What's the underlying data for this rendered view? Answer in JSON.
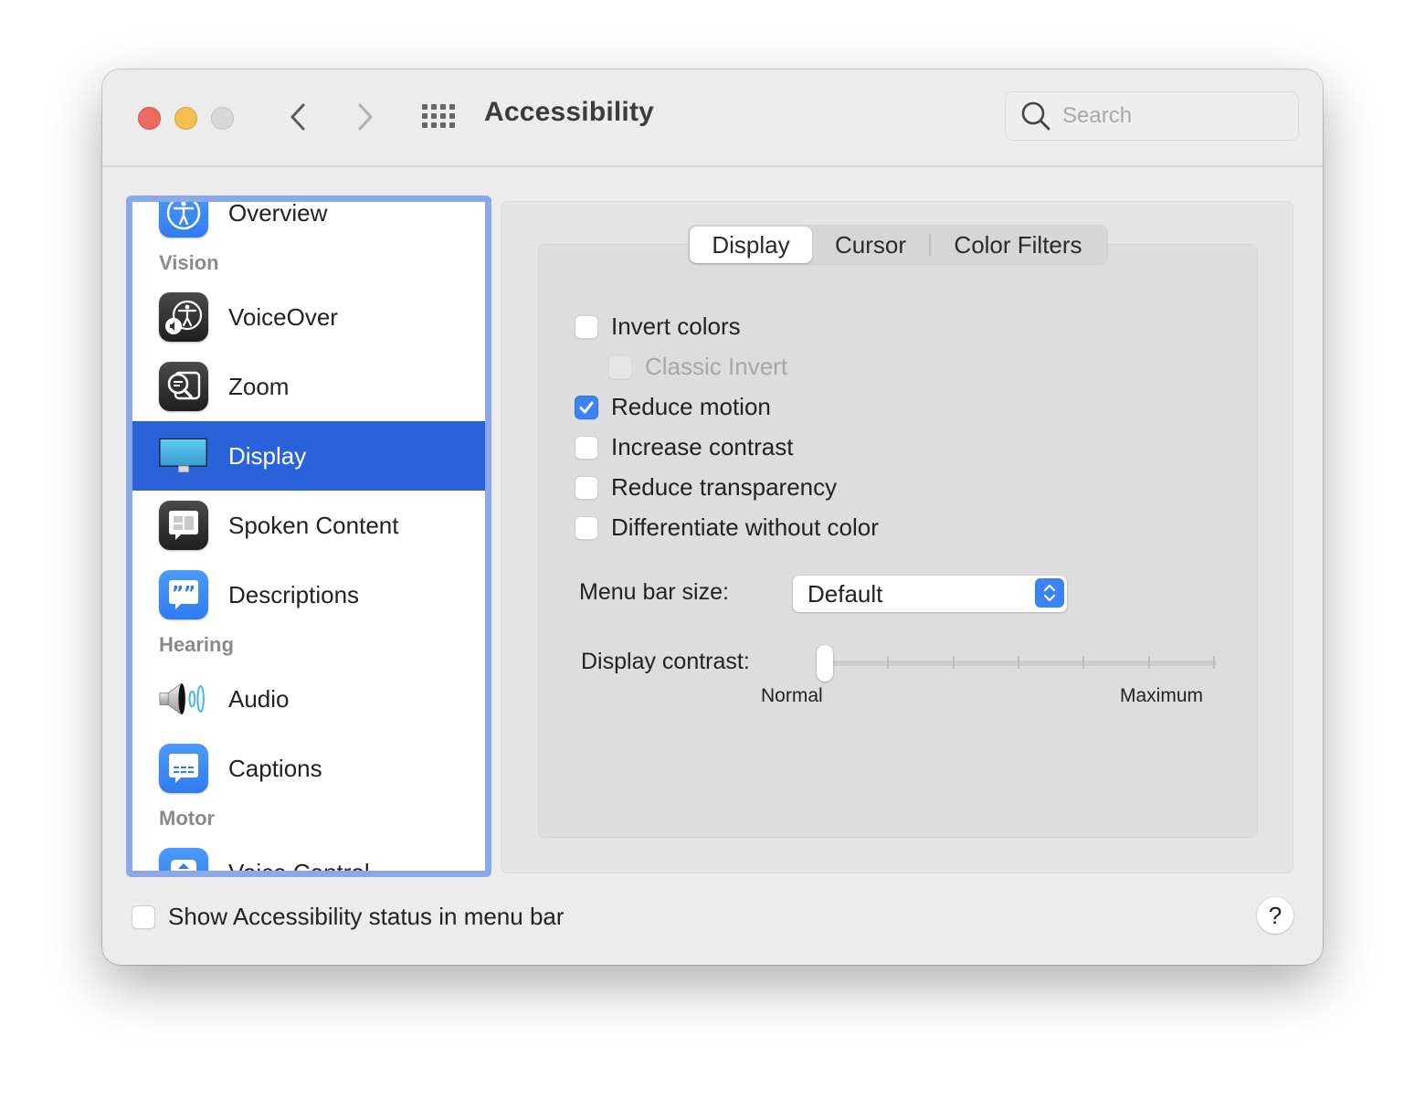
{
  "window": {
    "title": "Accessibility",
    "search": {
      "placeholder": "Search",
      "value": ""
    },
    "icons": {
      "close": "close-button",
      "minimize": "minimize-button",
      "zoom": "zoom-button",
      "back": "chevron-left-icon",
      "forward": "chevron-right-icon",
      "show_all": "grid-icon",
      "search": "magnifier-icon"
    }
  },
  "sidebar": {
    "items": [
      {
        "type": "item",
        "label": "Overview",
        "icon": "accessibility-person-icon",
        "selected": false
      },
      {
        "type": "section",
        "label": "Vision"
      },
      {
        "type": "item",
        "label": "VoiceOver",
        "icon": "voiceover-icon",
        "selected": false
      },
      {
        "type": "item",
        "label": "Zoom",
        "icon": "zoom-magnifier-icon",
        "selected": false
      },
      {
        "type": "item",
        "label": "Display",
        "icon": "monitor-icon",
        "selected": true
      },
      {
        "type": "item",
        "label": "Spoken Content",
        "icon": "speech-bubble-icon",
        "selected": false
      },
      {
        "type": "item",
        "label": "Descriptions",
        "icon": "quote-bubble-icon",
        "selected": false
      },
      {
        "type": "section",
        "label": "Hearing"
      },
      {
        "type": "item",
        "label": "Audio",
        "icon": "speaker-icon",
        "selected": false
      },
      {
        "type": "item",
        "label": "Captions",
        "icon": "captions-bubble-icon",
        "selected": false
      },
      {
        "type": "section",
        "label": "Motor"
      },
      {
        "type": "item",
        "label": "Voice Control",
        "icon": "voice-control-icon",
        "selected": false
      }
    ]
  },
  "main": {
    "tabs": [
      {
        "label": "Display",
        "active": true
      },
      {
        "label": "Cursor",
        "active": false
      },
      {
        "label": "Color Filters",
        "active": false
      }
    ],
    "options": [
      {
        "label": "Invert colors",
        "checked": false,
        "disabled": false,
        "indent": false
      },
      {
        "label": "Classic Invert",
        "checked": false,
        "disabled": true,
        "indent": true
      },
      {
        "label": "Reduce motion",
        "checked": true,
        "disabled": false,
        "indent": false
      },
      {
        "label": "Increase contrast",
        "checked": false,
        "disabled": false,
        "indent": false
      },
      {
        "label": "Reduce transparency",
        "checked": false,
        "disabled": false,
        "indent": false
      },
      {
        "label": "Differentiate without color",
        "checked": false,
        "disabled": false,
        "indent": false
      }
    ],
    "menu_bar_size": {
      "label": "Menu bar size:",
      "value": "Default"
    },
    "display_contrast": {
      "label": "Display contrast:",
      "min_label": "Normal",
      "max_label": "Maximum",
      "value": 0,
      "min": 0,
      "max": 1,
      "tick_count": 7
    }
  },
  "footer": {
    "show_status": {
      "label": "Show Accessibility status in menu bar",
      "checked": false
    },
    "help_label": "?"
  },
  "colors": {
    "accent": "#3b82f6",
    "selection": "#2962d9",
    "focus_ring": "#8ba8ea"
  }
}
